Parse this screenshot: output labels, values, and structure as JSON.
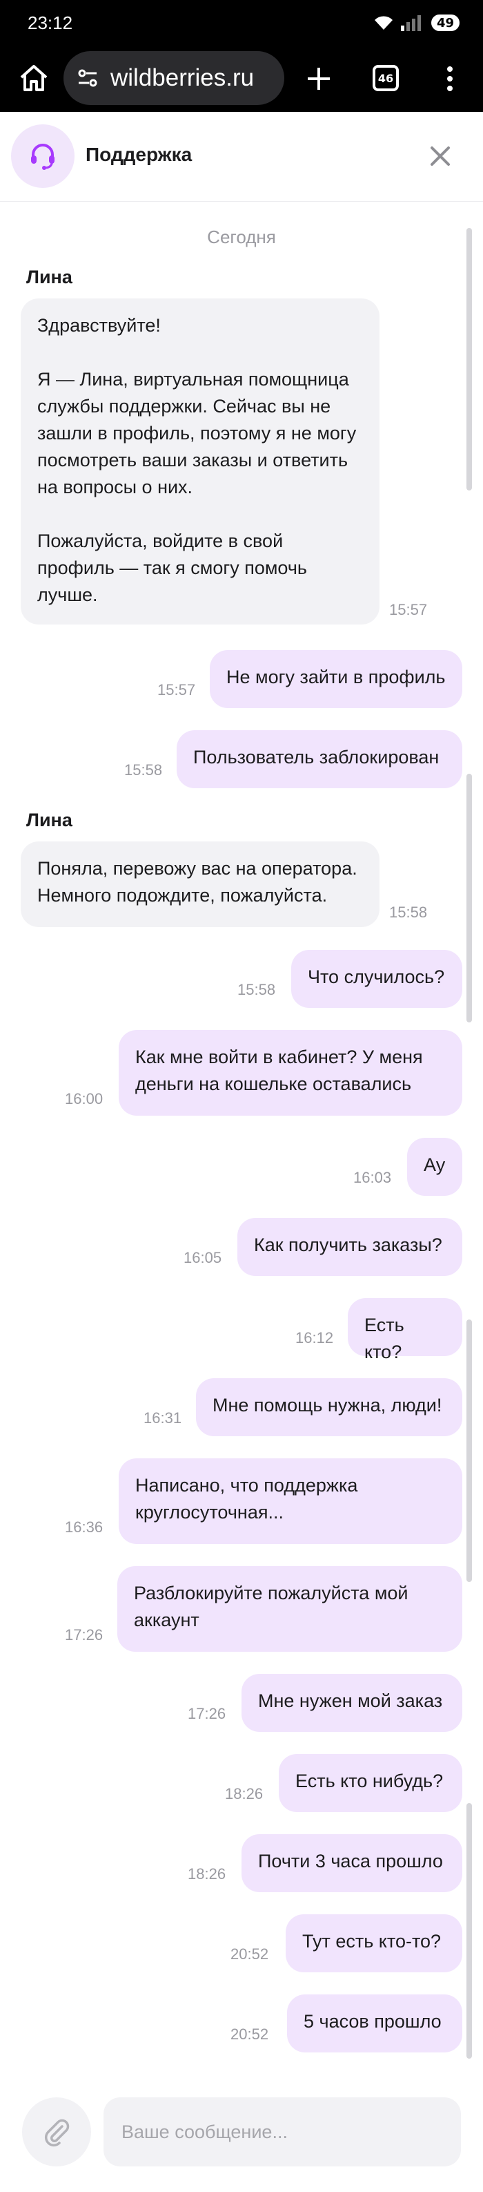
{
  "status_bar": {
    "time": "23:12",
    "battery": "49"
  },
  "browser": {
    "url": "wildberries.ru",
    "tab_count": "46"
  },
  "chat": {
    "title": "Поддержка",
    "date_separator": "Сегодня",
    "input_placeholder": "Ваше сообщение..."
  },
  "messages": [
    {
      "type": "in",
      "sender": "Лина",
      "text": "Здравствуйте!\n\nЯ — Лина, виртуальная помощница службы поддержки. Сейчас вы не зашли в профиль, поэтому я не могу посмотреть ваши заказы и ответить на вопросы о них.\n\nПожалуйста, войдите в свой профиль — так я смогу помочь лучше.",
      "time": "15:57"
    },
    {
      "type": "out",
      "text": "Не могу зайти в профиль",
      "time": "15:57"
    },
    {
      "type": "out",
      "text": "Пользователь заблокирован",
      "time": "15:58"
    },
    {
      "type": "in",
      "sender": "Лина",
      "text": "Поняла, перевожу вас на оператора. Немного подождите, пожалуйста.",
      "time": "15:58"
    },
    {
      "type": "out",
      "text": "Что случилось?",
      "time": "15:58"
    },
    {
      "type": "out",
      "text": "Как мне войти в кабинет? У меня деньги на кошельке оставались",
      "time": "16:00"
    },
    {
      "type": "out",
      "text": "Ау",
      "time": "16:03"
    },
    {
      "type": "out",
      "text": "Как получить заказы?",
      "time": "16:05"
    },
    {
      "type": "out",
      "text": "Есть кто?",
      "time": "16:12"
    },
    {
      "type": "out",
      "text": "Мне помощь нужна, люди!",
      "time": "16:31"
    },
    {
      "type": "out",
      "text": "Написано, что поддержка круглосуточная...",
      "time": "16:36"
    },
    {
      "type": "out",
      "text": "Разблокируйте пожалуйста мой аккаунт",
      "time": "17:26"
    },
    {
      "type": "out",
      "text": "Мне нужен мой заказ",
      "time": "17:26"
    },
    {
      "type": "out",
      "text": "Есть кто нибудь?",
      "time": "18:26"
    },
    {
      "type": "out",
      "text": "Почти 3 часа прошло",
      "time": "18:26"
    },
    {
      "type": "out",
      "text": "Тут есть кто-то?",
      "time": "20:52"
    },
    {
      "type": "out",
      "text": "5 часов прошло",
      "time": "20:52"
    }
  ],
  "colors": {
    "accent": "#a73afd",
    "outgoing_bubble": "#f1e4fd",
    "incoming_bubble": "#f2f2f5"
  },
  "icons": {
    "home": "home-icon",
    "site_settings": "site-settings-icon",
    "new_tab": "plus-icon",
    "menu": "more-vertical-icon",
    "agent": "headset-icon",
    "close": "close-icon",
    "attach": "paperclip-icon"
  }
}
